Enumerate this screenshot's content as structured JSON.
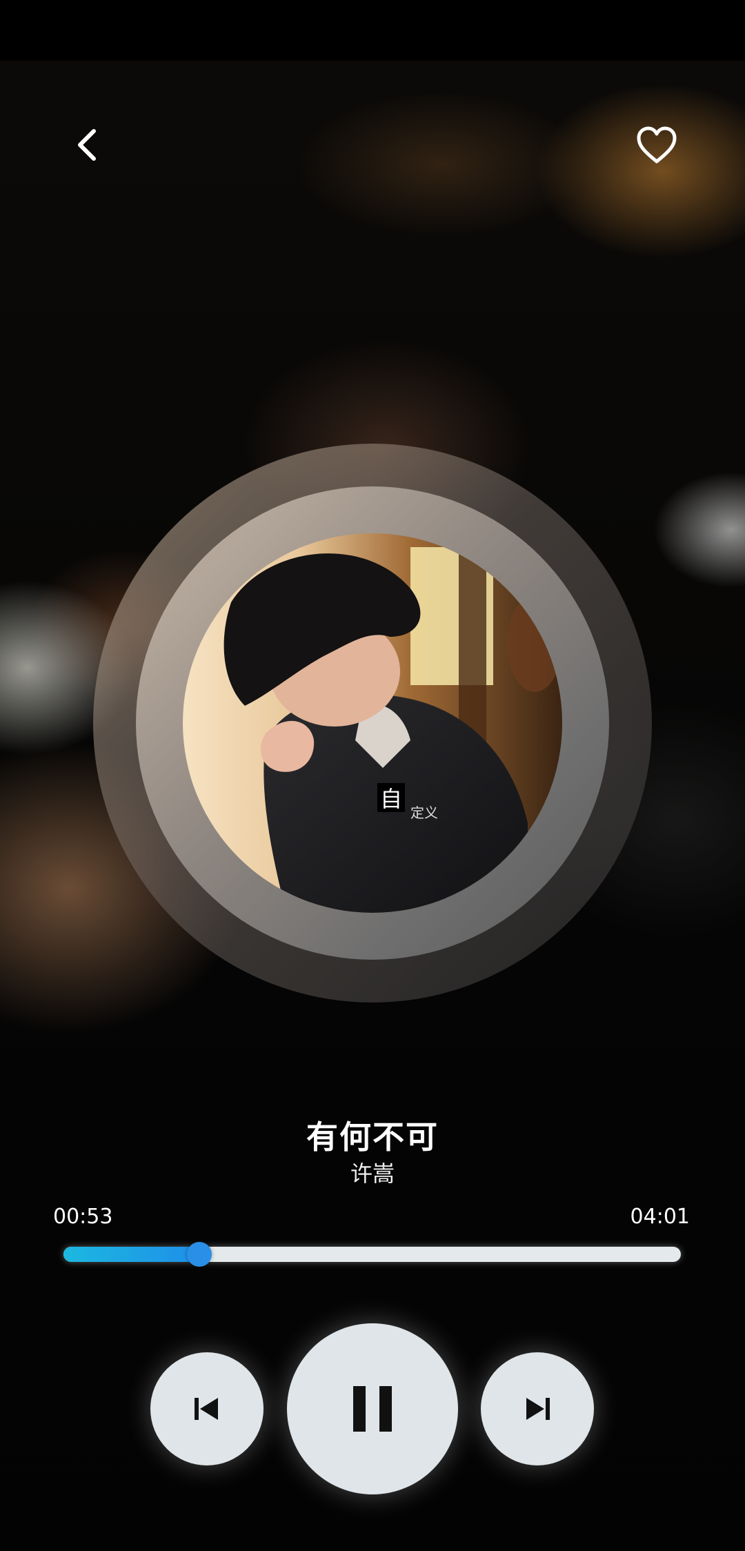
{
  "player": {
    "song_title": "有何不可",
    "artist": "许嵩",
    "current_time": "00:53",
    "total_time": "04:01",
    "progress": 0.22,
    "is_playing": true,
    "is_favorite": false
  },
  "icons": {
    "back": "chevron-left-icon",
    "favorite": "heart-outline-icon",
    "previous": "skip-previous-icon",
    "pause": "pause-icon",
    "next": "skip-next-icon"
  },
  "colors": {
    "progress_fill": "#1e8fe8",
    "progress_track": "#e4e9ec",
    "control_bg": "#dfe5e8",
    "control_icon": "#111111"
  },
  "album_art": {
    "caption_char": "自",
    "caption_sub": "定义"
  }
}
